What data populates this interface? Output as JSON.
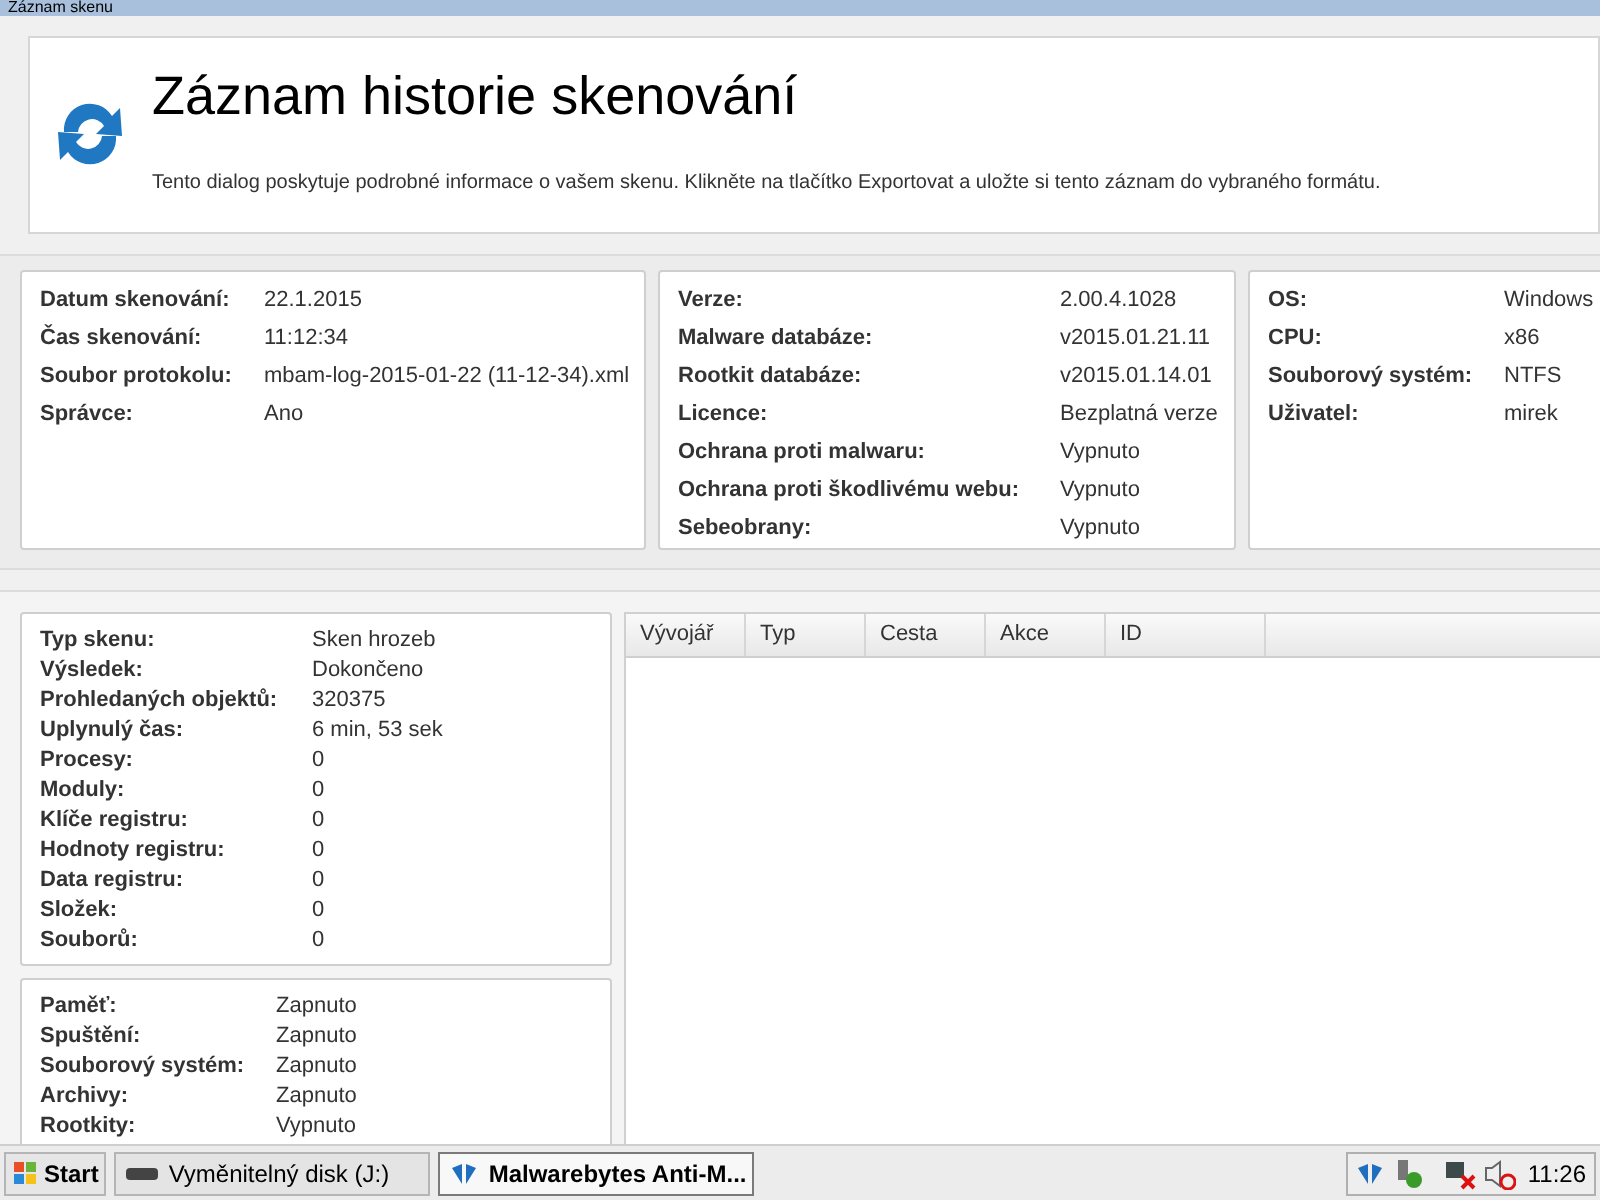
{
  "window": {
    "title": "Záznam skenu"
  },
  "header": {
    "title": "Záznam historie skenování",
    "description": "Tento dialog poskytuje podrobné informace o vašem skenu. Klikněte na tlačítko Exportovat a uložte si tento záznam do vybraného formátu."
  },
  "info_panels": [
    {
      "rows": [
        {
          "label": "Datum skenování:",
          "value": "22.1.2015"
        },
        {
          "label": "Čas skenování:",
          "value": "11:12:34"
        },
        {
          "label": "Soubor protokolu:",
          "value": "mbam-log-2015-01-22 (11-12-34).xml"
        },
        {
          "label": "Správce:",
          "value": "Ano"
        }
      ]
    },
    {
      "rows": [
        {
          "label": "Verze:",
          "value": "2.00.4.1028"
        },
        {
          "label": "Malware databáze:",
          "value": "v2015.01.21.11"
        },
        {
          "label": "Rootkit databáze:",
          "value": "v2015.01.14.01"
        },
        {
          "label": "Licence:",
          "value": "Bezplatná verze"
        },
        {
          "label": "Ochrana proti malwaru:",
          "value": "Vypnuto"
        },
        {
          "label": "Ochrana proti škodlivému webu:",
          "value": "Vypnuto"
        },
        {
          "label": "Sebeobrany:",
          "value": "Vypnuto"
        }
      ]
    },
    {
      "rows": [
        {
          "label": "OS:",
          "value": "Windows"
        },
        {
          "label": "CPU:",
          "value": "x86"
        },
        {
          "label": "Souborový systém:",
          "value": "NTFS"
        },
        {
          "label": "Uživatel:",
          "value": "mirek"
        }
      ]
    }
  ],
  "scan_summary": [
    {
      "rows": [
        {
          "label": "Typ skenu:",
          "value": "Sken hrozeb"
        },
        {
          "label": "Výsledek:",
          "value": "Dokončeno"
        },
        {
          "label": "Prohledaných objektů:",
          "value": "320375"
        },
        {
          "label": "Uplynulý čas:",
          "value": "6 min, 53 sek"
        },
        {
          "label": "Procesy:",
          "value": "0"
        },
        {
          "label": "Moduly:",
          "value": "0"
        },
        {
          "label": "Klíče registru:",
          "value": "0"
        },
        {
          "label": "Hodnoty registru:",
          "value": "0"
        },
        {
          "label": "Data registru:",
          "value": "0"
        },
        {
          "label": "Složek:",
          "value": "0"
        },
        {
          "label": "Souborů:",
          "value": "0"
        }
      ]
    },
    {
      "rows": [
        {
          "label": "Paměť:",
          "value": "Zapnuto"
        },
        {
          "label": "Spuštění:",
          "value": "Zapnuto"
        },
        {
          "label": "Souborový systém:",
          "value": "Zapnuto"
        },
        {
          "label": "Archivy:",
          "value": "Zapnuto"
        },
        {
          "label": "Rootkity:",
          "value": "Vypnuto"
        }
      ]
    }
  ],
  "table": {
    "columns": [
      "Vývojář",
      "Typ",
      "Cesta",
      "Akce",
      "ID"
    ]
  },
  "taskbar": {
    "start": "Start",
    "tasks": [
      {
        "label": "Vyměnitelný disk (J:)",
        "selected": false
      },
      {
        "label": "Malwarebytes Anti-M...",
        "selected": true
      }
    ],
    "clock": "11:26"
  }
}
